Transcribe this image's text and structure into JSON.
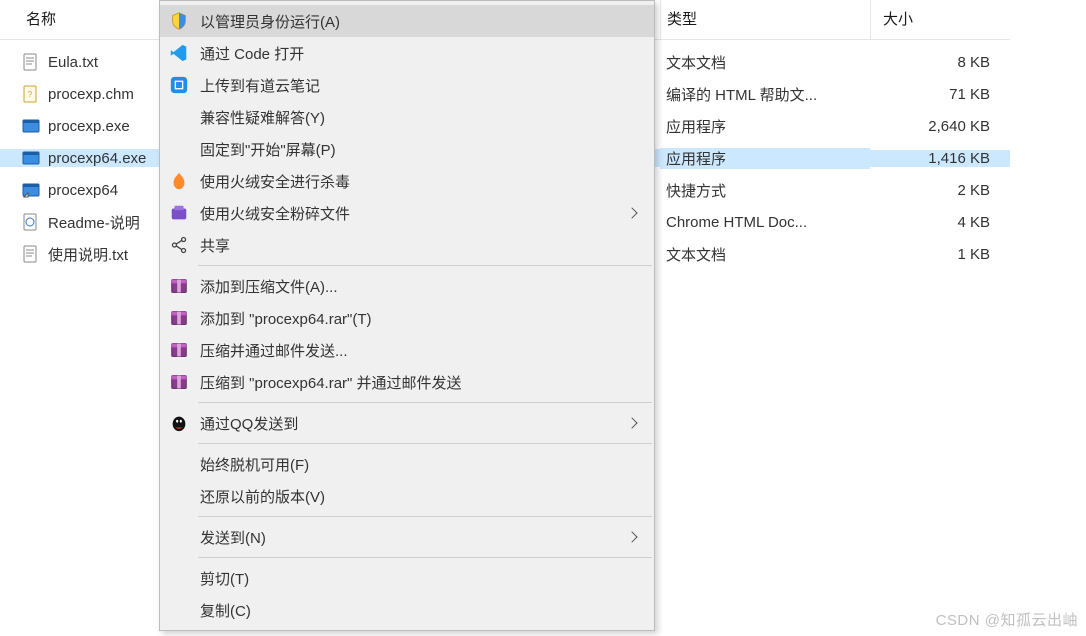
{
  "headers": {
    "name": "名称",
    "type": "类型",
    "size": "大小"
  },
  "files": [
    {
      "name": "Eula.txt",
      "type": "文本文档",
      "size": "8 KB",
      "icon": "txt"
    },
    {
      "name": "procexp.chm",
      "type": "编译的 HTML 帮助文...",
      "size": "71 KB",
      "icon": "chm"
    },
    {
      "name": "procexp.exe",
      "type": "应用程序",
      "size": "2,640 KB",
      "icon": "exe"
    },
    {
      "name": "procexp64.exe",
      "type": "应用程序",
      "size": "1,416 KB",
      "icon": "exe",
      "selected": true
    },
    {
      "name": "procexp64",
      "type": "快捷方式",
      "size": "2 KB",
      "icon": "lnk"
    },
    {
      "name": "Readme-说明",
      "type": "Chrome HTML Doc...",
      "size": "4 KB",
      "icon": "html"
    },
    {
      "name": "使用说明.txt",
      "type": "文本文档",
      "size": "1 KB",
      "icon": "txt"
    }
  ],
  "context_menu": [
    {
      "kind": "item",
      "label": "以管理员身份运行(A)",
      "icon": "shield",
      "hover": true
    },
    {
      "kind": "item",
      "label": "通过 Code 打开",
      "icon": "vscode"
    },
    {
      "kind": "item",
      "label": "上传到有道云笔记",
      "icon": "youdao"
    },
    {
      "kind": "item",
      "label": "兼容性疑难解答(Y)"
    },
    {
      "kind": "item",
      "label": "固定到\"开始\"屏幕(P)"
    },
    {
      "kind": "item",
      "label": "使用火绒安全进行杀毒",
      "icon": "huorong"
    },
    {
      "kind": "item",
      "label": "使用火绒安全粉碎文件",
      "icon": "huorong2",
      "submenu": true
    },
    {
      "kind": "item",
      "label": "共享",
      "icon": "share"
    },
    {
      "kind": "sep"
    },
    {
      "kind": "item",
      "label": "添加到压缩文件(A)...",
      "icon": "rar"
    },
    {
      "kind": "item",
      "label": "添加到 \"procexp64.rar\"(T)",
      "icon": "rar"
    },
    {
      "kind": "item",
      "label": "压缩并通过邮件发送...",
      "icon": "rar"
    },
    {
      "kind": "item",
      "label": "压缩到 \"procexp64.rar\" 并通过邮件发送",
      "icon": "rar"
    },
    {
      "kind": "sep"
    },
    {
      "kind": "item",
      "label": "通过QQ发送到",
      "icon": "qq",
      "submenu": true
    },
    {
      "kind": "sep"
    },
    {
      "kind": "item",
      "label": "始终脱机可用(F)"
    },
    {
      "kind": "item",
      "label": "还原以前的版本(V)"
    },
    {
      "kind": "sep"
    },
    {
      "kind": "item",
      "label": "发送到(N)",
      "submenu": true
    },
    {
      "kind": "sep"
    },
    {
      "kind": "item",
      "label": "剪切(T)"
    },
    {
      "kind": "item",
      "label": "复制(C)"
    }
  ],
  "watermark": "CSDN @知孤云出岫"
}
